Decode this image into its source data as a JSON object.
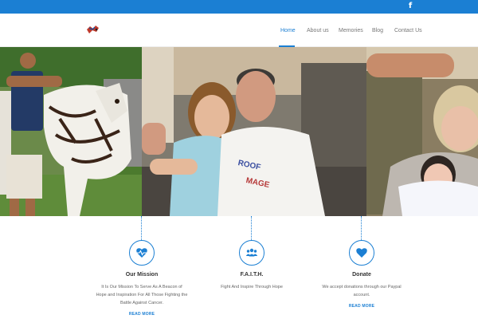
{
  "social": {
    "facebook_glyph": "f",
    "icon": "facebook-icon"
  },
  "nav": {
    "items": [
      {
        "label": "Home",
        "active": true
      },
      {
        "label": "About us",
        "active": false
      },
      {
        "label": "Memories",
        "active": false
      },
      {
        "label": "Blog",
        "active": false
      },
      {
        "label": "Contact Us",
        "active": false
      }
    ]
  },
  "slider": {
    "slide_count": 2,
    "active_slide": 1
  },
  "features": [
    {
      "icon": "heartbeat-icon",
      "title": "Our Mission",
      "lines": [
        "It Is Our Mission To Serve As A Beacon of",
        "Hope and Inspiration For All Those Fighting the",
        "Battle Against Cancer."
      ],
      "link": "READ MORE"
    },
    {
      "icon": "group-icon",
      "title": "F.A.I.T.H.",
      "lines": [
        "Fight And Inspire Through Hope"
      ],
      "link": ""
    },
    {
      "icon": "heart-icon",
      "title": "Donate",
      "lines": [
        "We accept donations through our Paypal",
        "account."
      ],
      "link": "READ MORE"
    }
  ],
  "colors": {
    "accent": "#1b7fd3",
    "topbar": "#1b7fd3"
  }
}
